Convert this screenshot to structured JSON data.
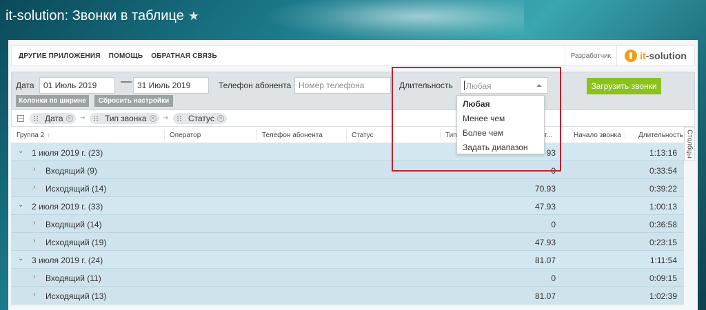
{
  "app": {
    "title": "it-solution: Звонки в таблице",
    "favorite_icon": "star-icon"
  },
  "topmenu": {
    "items": [
      "ДРУГИЕ ПРИЛОЖЕНИЯ",
      "ПОМОЩЬ",
      "ОБРАТНАЯ СВЯЗЬ"
    ],
    "developer_label": "Разработчик",
    "logo_text_a": "it",
    "logo_text_b": "-solution"
  },
  "filters": {
    "date_label": "Дата",
    "date_from": "01 Июль 2019",
    "date_to": "31 Июль 2019",
    "dash": "—",
    "phone_label": "Телефон абонента",
    "phone_placeholder": "Номер телефона",
    "duration_label": "Длительность",
    "duration_placeholder": "Любая",
    "load_button": "Загрузить звонки",
    "fit_columns_button": "Колонки по ширине",
    "reset_button": "Сбросить настройки",
    "accent_color": "#8bc21d"
  },
  "duration_dropdown": {
    "options": [
      "Любая",
      "Менее чем",
      "Более чем",
      "Задать диапазон"
    ],
    "selected": "Любая"
  },
  "grouping": {
    "chips": [
      "Дата",
      "Тип звонка",
      "Статус"
    ]
  },
  "table": {
    "headers": {
      "group": "Группа 2",
      "operator": "Оператор",
      "phone": "Телефон абонента",
      "status": "Статус",
      "type": "Тип",
      "cost": "т...",
      "start": "Начало звонка",
      "duration": "Длительность"
    },
    "columns_tab": "Столбцы",
    "rows": [
      {
        "label": "1 июля 2019 г. (23)",
        "value": "93",
        "duration": "1:13:16",
        "level": 0
      },
      {
        "label": "Входящий (9)",
        "value": "0",
        "duration": "0:33:54",
        "level": 1
      },
      {
        "label": "Исходящий (14)",
        "value": "70.93",
        "duration": "0:39:22",
        "level": 1
      },
      {
        "label": "2 июля 2019 г. (33)",
        "value": "47.93",
        "duration": "1:00:13",
        "level": 0
      },
      {
        "label": "Входящий (14)",
        "value": "0",
        "duration": "0:36:58",
        "level": 1
      },
      {
        "label": "Исходящий (19)",
        "value": "47.93",
        "duration": "0:23:15",
        "level": 1
      },
      {
        "label": "3 июля 2019 г. (24)",
        "value": "81.07",
        "duration": "1:11:54",
        "level": 0
      },
      {
        "label": "Входящий (11)",
        "value": "0",
        "duration": "0:09:15",
        "level": 1
      },
      {
        "label": "Исходящий (13)",
        "value": "81.07",
        "duration": "1:02:39",
        "level": 1
      }
    ]
  }
}
